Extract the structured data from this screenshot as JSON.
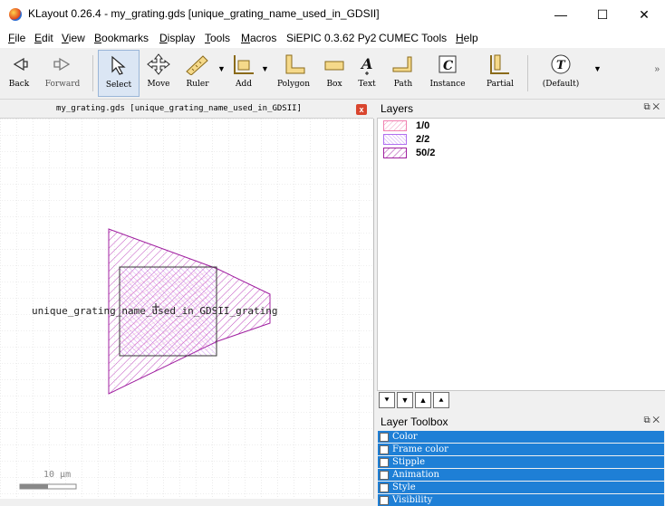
{
  "window": {
    "title": "KLayout 0.26.4 - my_grating.gds [unique_grating_name_used_in_GDSII]",
    "minimize": "—",
    "maximize": "☐",
    "close": "✕"
  },
  "menu": [
    {
      "label": "File",
      "ul": "F",
      "rest": "ile"
    },
    {
      "label": "Edit",
      "ul": "E",
      "rest": "dit"
    },
    {
      "label": "View",
      "ul": "V",
      "rest": "iew"
    },
    {
      "label": "Bookmarks",
      "ul": "B",
      "rest": "ookmarks"
    },
    {
      "label": "Display",
      "ul": "D",
      "rest": "isplay"
    },
    {
      "label": "Tools",
      "ul": "T",
      "rest": "ools"
    },
    {
      "label": "Macros",
      "ul": "M",
      "rest": "acros"
    },
    {
      "label": "SiEPIC 0.3.62 Py2",
      "ul": "",
      "rest": "SiEPIC 0.3.62 Py2"
    },
    {
      "label": "CUMEC Tools",
      "ul": "",
      "rest": "CUMEC Tools"
    },
    {
      "label": "Help",
      "ul": "H",
      "rest": "elp"
    }
  ],
  "toolbar": {
    "back": "Back",
    "forward": "Forward",
    "select": "Select",
    "move": "Move",
    "ruler": "Ruler",
    "add": "Add",
    "polygon": "Polygon",
    "box": "Box",
    "text": "Text",
    "path": "Path",
    "instance": "Instance",
    "partial": "Partial",
    "default": "(Default)",
    "more": "»"
  },
  "layout_view": {
    "tab_title": "my_grating.gds [unique_grating_name_used_in_GDSII]",
    "close": "x",
    "shape_text": "unique_grating_name_used_in_GDSII_grating",
    "scale_bar": "10 µm"
  },
  "layers_panel": {
    "title": "Layers",
    "controls": "⧉  ✕",
    "layers": [
      {
        "name": "1/0",
        "color": "#f080b0"
      },
      {
        "name": "2/2",
        "color": "#b070f0"
      },
      {
        "name": "50/2",
        "color": "#a020a0"
      }
    ]
  },
  "layer_buttons": [
    "⯆",
    "▼",
    "▲",
    "⯅"
  ],
  "toolbox": {
    "title": "Layer Toolbox",
    "controls": "⧉  ✕",
    "items": [
      "Color",
      "Frame color",
      "Stipple",
      "Animation",
      "Style",
      "Visibility"
    ]
  },
  "colors": {
    "accent": "#1e7fd6",
    "layer_1_0": "#f080b0",
    "layer_2_2": "#b070f0",
    "layer_50_2": "#a020a0"
  }
}
